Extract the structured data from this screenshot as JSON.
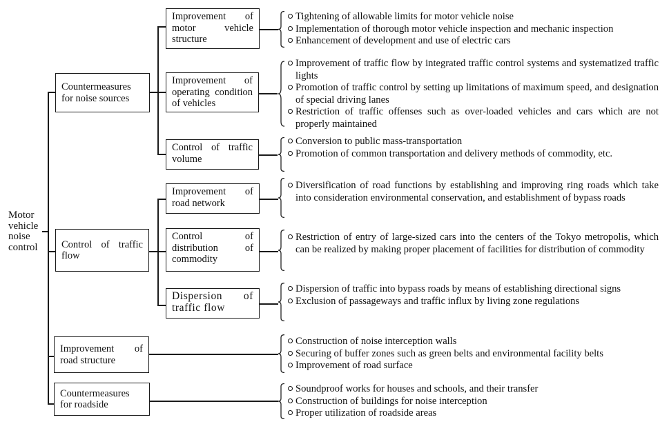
{
  "root": {
    "label": "Motor vehicle noise control"
  },
  "categories": [
    {
      "label": "Countermeasures for noise sources",
      "subcategories": [
        {
          "label": "Improvement of motor vehicle structure",
          "measures": [
            "Tightening of allowable limits for motor vehicle noise",
            "Implementation of thorough motor vehicle inspection and mechanic inspection",
            "Enhancement of development and use of electric cars"
          ]
        },
        {
          "label": "Improvement of operating condition of vehicles",
          "measures": [
            "Improvement of traffic flow by integrated traffic control systems and systematized traffic lights",
            "Promotion of traffic control by setting up limitations of maximum speed, and designation of special driving lanes",
            "Restriction of traffic offenses such as over-loaded vehicles and cars which are not properly maintained"
          ]
        },
        {
          "label": "Control of traffic volume",
          "measures": [
            "Conversion to public mass-transportation",
            "Promotion of common transportation and delivery methods of commodity, etc."
          ]
        }
      ]
    },
    {
      "label": "Control of traffic flow",
      "subcategories": [
        {
          "label": "Improvement of road network",
          "measures": [
            "Diversification of road functions by establishing and improving ring roads which take into consideration environmental conservation, and establishment of bypass roads"
          ]
        },
        {
          "label": "Control of distribution of commodity",
          "measures": [
            "Restriction of entry of large-sized cars into the centers of the Tokyo metropolis, which can be realized by making proper placement of facilities for distribution of commodity"
          ]
        },
        {
          "label": "Dispersion of traffic flow",
          "measures": [
            "Dispersion of traffic into bypass roads by means of establishing directional signs",
            "Exclusion of passageways and traffic influx by living zone regulations"
          ]
        }
      ]
    },
    {
      "label": "Improvement of road structure",
      "measures": [
        "Construction of noise interception walls",
        "Securing of buffer zones such as green belts and environmental facility belts",
        "Improvement of road surface"
      ]
    },
    {
      "label": "Countermeasures for roadside",
      "measures": [
        "Soundproof works for houses and schools, and their transfer",
        "Construction of buildings for noise interception",
        "Proper utilization of roadside areas"
      ]
    }
  ]
}
